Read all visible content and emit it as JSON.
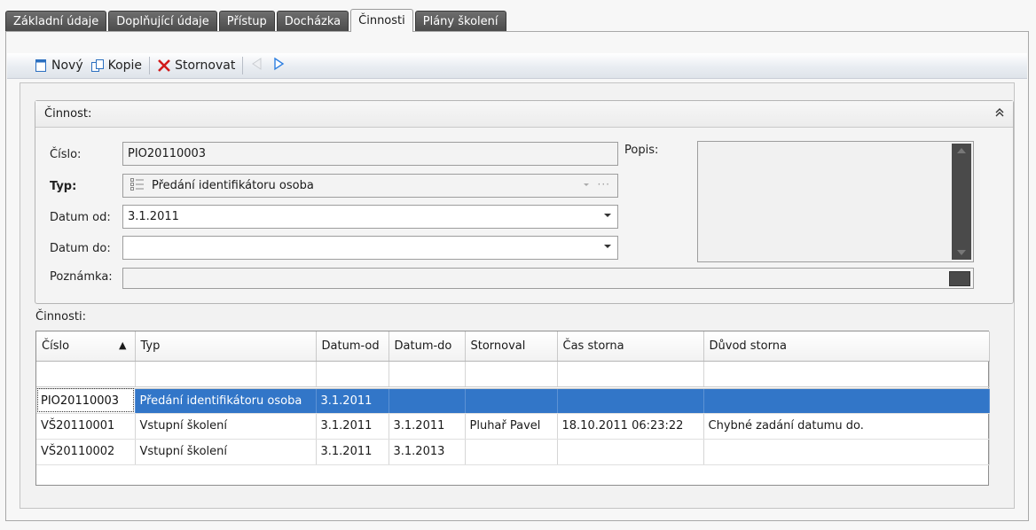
{
  "tabs": [
    {
      "label": "Základní údaje",
      "active": false
    },
    {
      "label": "Doplňující údaje",
      "active": false
    },
    {
      "label": "Přístup",
      "active": false
    },
    {
      "label": "Docházka",
      "active": false
    },
    {
      "label": "Činnosti",
      "active": true
    },
    {
      "label": "Plány školení",
      "active": false
    }
  ],
  "toolbar": {
    "new_label": "Nový",
    "copy_label": "Kopie",
    "cancel_label": "Stornovat",
    "colors": {
      "new": "#2b6fc0",
      "cancel": "#d11a1a",
      "arrow_disabled": "#c9ccd1",
      "arrow_next": "#2e7fe0"
    }
  },
  "form": {
    "group_title": "Činnost:",
    "cislo_label": "Číslo:",
    "cislo_value": "PIO20110003",
    "typ_label": "Typ:",
    "typ_value": "Předání identifikátoru osoba",
    "datum_od_label": "Datum od:",
    "datum_od_value": "3.1.2011",
    "datum_do_label": "Datum do:",
    "datum_do_value": "",
    "poznamka_label": "Poznámka:",
    "poznamka_value": "",
    "popis_label": "Popis:",
    "popis_value": ""
  },
  "grid": {
    "title": "Činnosti:",
    "columns": [
      "Číslo",
      "Typ",
      "Datum-od",
      "Datum-do",
      "Stornoval",
      "Čas storna",
      "Důvod storna"
    ],
    "rows": [
      [
        "PIO20110003",
        "Předání identifikátoru osoba",
        "3.1.2011",
        "",
        "",
        "",
        ""
      ],
      [
        "VŠ20110001",
        "Vstupní školení",
        "3.1.2011",
        "3.1.2011",
        "Pluhař Pavel",
        "18.10.2011 06:23:22",
        "Chybné zadání datumu do."
      ],
      [
        "VŠ20110002",
        "Vstupní školení",
        "3.1.2011",
        "3.1.2013",
        "",
        "",
        ""
      ]
    ],
    "selected_row": 0,
    "selection_color": "#3276c8"
  }
}
